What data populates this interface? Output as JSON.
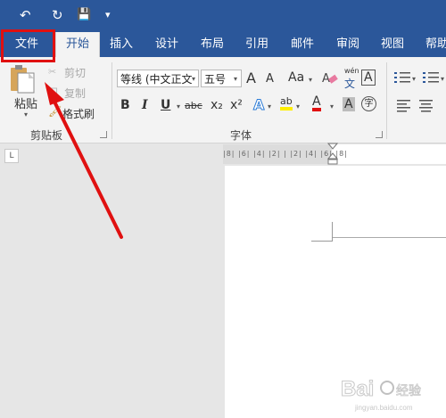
{
  "quick_access": {
    "undo_icon": "↶",
    "redo_icon": "↻",
    "save_icon": "💾",
    "more_icon": "▾"
  },
  "tabs": [
    "文件",
    "开始",
    "插入",
    "设计",
    "布局",
    "引用",
    "邮件",
    "审阅",
    "视图",
    "帮助"
  ],
  "clipboard": {
    "paste": "粘贴",
    "cut": "剪切",
    "copy": "复制",
    "format_painter": "格式刷",
    "group_label": "剪贴板"
  },
  "font": {
    "font_name": "等线 (中文正文",
    "font_size": "五号",
    "grow": "A",
    "shrink": "A",
    "change_case": "Aa",
    "phonetic_top": "wén",
    "phonetic_bottom": "文",
    "char_border": "A",
    "bold": "B",
    "italic": "I",
    "underline": "U",
    "strike": "abc",
    "subscript": "x₂",
    "superscript": "x²",
    "text_effect": "A",
    "highlight": "ab",
    "font_color": "A",
    "char_shading": "A",
    "enclose": "字",
    "group_label": "字体"
  },
  "ruler": {
    "text": "|8|  |6|  |4|  |2|    |   |2|  |4|  |6|  |8|"
  },
  "colors": {
    "brand": "#2b579a",
    "annotation_red": "#e01010"
  }
}
